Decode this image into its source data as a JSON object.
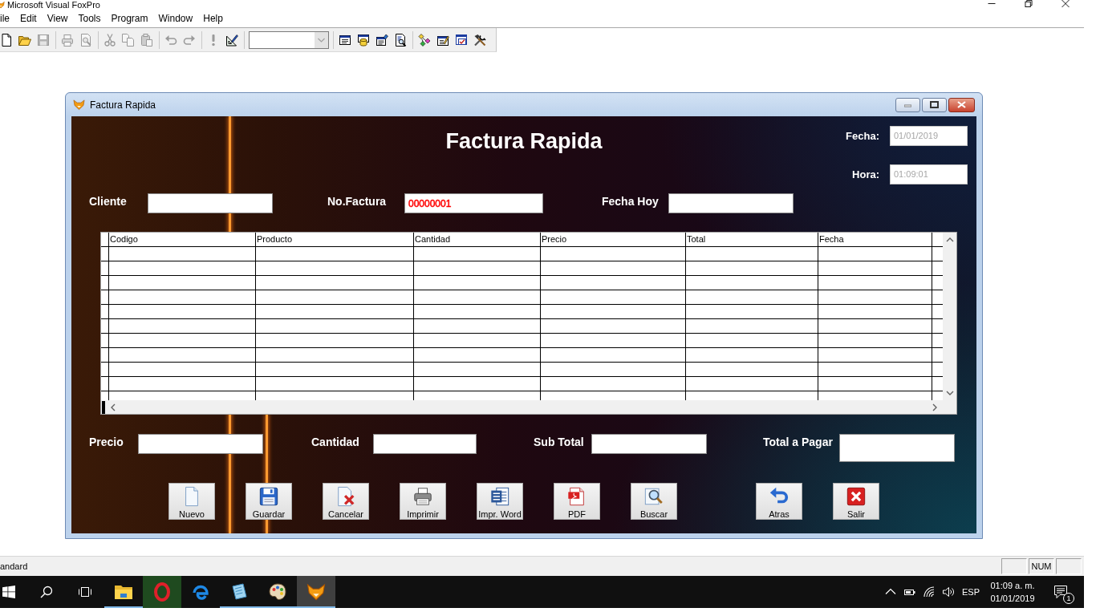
{
  "app_window": {
    "title": "Microsoft Visual FoxPro"
  },
  "menu": [
    {
      "label": "ile"
    },
    {
      "label": "Edit"
    },
    {
      "label": "View"
    },
    {
      "label": "Tools"
    },
    {
      "label": "Program"
    },
    {
      "label": "Window"
    },
    {
      "label": "Help"
    }
  ],
  "toolbar": {
    "groups": [
      {
        "buttons": [
          {
            "kind": "new",
            "disabled": false
          },
          {
            "kind": "open",
            "disabled": false
          },
          {
            "kind": "save",
            "disabled": true
          }
        ]
      },
      {
        "buttons": [
          {
            "kind": "print",
            "disabled": true
          },
          {
            "kind": "preview",
            "disabled": true
          }
        ]
      },
      {
        "buttons": [
          {
            "kind": "cut",
            "disabled": true
          },
          {
            "kind": "copy",
            "disabled": true
          },
          {
            "kind": "paste",
            "disabled": true
          }
        ]
      },
      {
        "buttons": [
          {
            "kind": "undo",
            "disabled": true
          },
          {
            "kind": "redo",
            "disabled": true
          }
        ]
      },
      {
        "buttons": [
          {
            "kind": "run",
            "disabled": true
          },
          {
            "kind": "modify",
            "disabled": false
          }
        ]
      },
      {
        "buttons": [
          {
            "kind": "combo",
            "disabled": true
          }
        ]
      },
      {
        "buttons": [
          {
            "kind": "command",
            "disabled": false
          },
          {
            "kind": "data",
            "disabled": false
          },
          {
            "kind": "properties",
            "disabled": false
          },
          {
            "kind": "code",
            "disabled": false
          }
        ]
      },
      {
        "buttons": [
          {
            "kind": "classes",
            "disabled": false
          },
          {
            "kind": "wizard",
            "disabled": false
          },
          {
            "kind": "forms",
            "disabled": false
          },
          {
            "kind": "tools",
            "disabled": false
          }
        ]
      }
    ]
  },
  "form": {
    "title": "Factura Rapida",
    "heading": "Factura Rapida",
    "stamp_fields": [
      {
        "label": "Fecha:",
        "value": "01/01/2019",
        "disabled": true
      },
      {
        "label": "Hora:",
        "value": "01:09:01",
        "disabled": true
      }
    ],
    "header_fields": [
      {
        "label": "Cliente"
      },
      {
        "label": "No.Factura",
        "value": "00000001",
        "color": "#ff0000"
      },
      {
        "label": "Fecha Hoy"
      }
    ],
    "grid": {
      "columns": [
        "Codigo",
        "Producto",
        "Cantidad",
        "Precio",
        "Total",
        "Fecha"
      ]
    },
    "total_fields": [
      {
        "label": "Precio"
      },
      {
        "label": "Cantidad"
      },
      {
        "label": "Sub Total"
      },
      {
        "label": "Total a Pagar"
      }
    ],
    "actions": [
      {
        "label": "Nuevo",
        "kind": "new"
      },
      {
        "label": "Guardar",
        "kind": "save"
      },
      {
        "label": "Cancelar",
        "kind": "cancel"
      },
      {
        "label": "Imprimir",
        "kind": "print"
      },
      {
        "label": "Impr. Word",
        "kind": "word"
      },
      {
        "label": "PDF",
        "kind": "pdf"
      },
      {
        "label": "Buscar",
        "kind": "search"
      }
    ],
    "nav_actions": [
      {
        "label": "Atras",
        "kind": "back"
      },
      {
        "label": "Salir",
        "kind": "exit"
      }
    ]
  },
  "status_bar": {
    "text": "andard",
    "panels": [
      {
        "kind": "blank"
      },
      {
        "kind": "text",
        "text": "NUM"
      },
      {
        "kind": "blank"
      }
    ]
  },
  "taskbar": {
    "apps": [
      {
        "kind": "folder",
        "running": true,
        "active": false,
        "highlighted": false
      },
      {
        "kind": "opera",
        "running": false,
        "active": false,
        "highlighted": true
      },
      {
        "kind": "edge",
        "running": false,
        "active": false,
        "highlighted": false
      },
      {
        "kind": "notes",
        "running": true,
        "active": false,
        "highlighted": false
      },
      {
        "kind": "paint",
        "running": true,
        "active": false,
        "highlighted": false
      },
      {
        "kind": "fox",
        "running": true,
        "active": true,
        "highlighted": false
      }
    ],
    "language": "ESP",
    "time": "01:09 a. m.",
    "date": "01/01/2019",
    "notifications": "1"
  }
}
